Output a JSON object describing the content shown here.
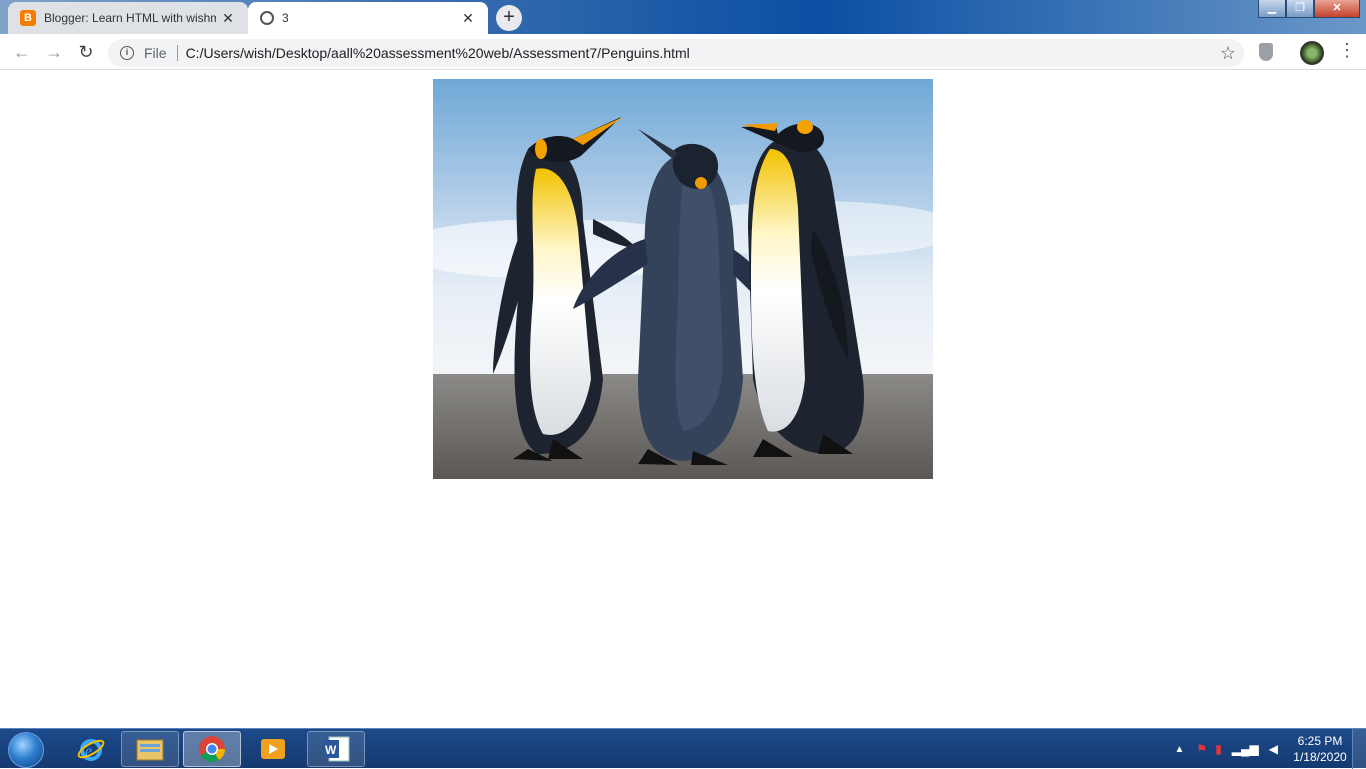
{
  "browser": {
    "tabs": [
      {
        "label": "Blogger: Learn HTML with wishm",
        "favicon": "blogger-icon",
        "active": false
      },
      {
        "label": "3",
        "favicon": "globe-icon",
        "active": true
      }
    ],
    "address": {
      "scheme_label": "File",
      "url": "C:/Users/wish/Desktop/aall%20assessment%20web/Assessment7/Penguins.html"
    }
  },
  "page": {
    "image_alt": "penguins"
  },
  "taskbar": {
    "apps": [
      "internet-explorer",
      "windows-explorer",
      "google-chrome",
      "media-player",
      "microsoft-word"
    ],
    "clock": {
      "time": "6:25 PM",
      "date": "1/18/2020"
    }
  }
}
